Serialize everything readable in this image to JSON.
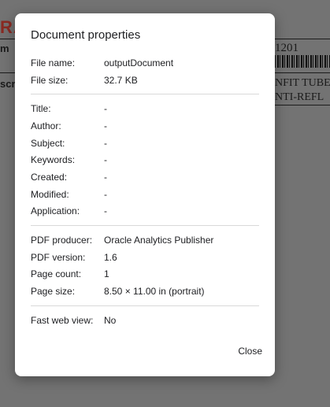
{
  "background": {
    "logo_fragment": "RA",
    "left_fragment_1": "m",
    "left_fragment_2": "scr",
    "number_fragment": "1201",
    "text_line_1": "NFIT TUBE",
    "text_line_2": "NTI-REFL"
  },
  "dialog": {
    "title": "Document properties",
    "file_info": [
      {
        "label": "File name:",
        "value": "outputDocument"
      },
      {
        "label": "File size:",
        "value": "32.7 KB"
      }
    ],
    "metadata": [
      {
        "label": "Title:",
        "value": "-"
      },
      {
        "label": "Author:",
        "value": "-"
      },
      {
        "label": "Subject:",
        "value": "-"
      },
      {
        "label": "Keywords:",
        "value": "-"
      },
      {
        "label": "Created:",
        "value": "-"
      },
      {
        "label": "Modified:",
        "value": "-"
      },
      {
        "label": "Application:",
        "value": "-"
      }
    ],
    "pdf_info": [
      {
        "label": "PDF producer:",
        "value": "Oracle Analytics Publisher"
      },
      {
        "label": "PDF version:",
        "value": "1.6"
      },
      {
        "label": "Page count:",
        "value": "1"
      },
      {
        "label": "Page size:",
        "value": "8.50 × 11.00 in (portrait)"
      }
    ],
    "web_info": [
      {
        "label": "Fast web view:",
        "value": "No"
      }
    ],
    "close_label": "Close"
  }
}
